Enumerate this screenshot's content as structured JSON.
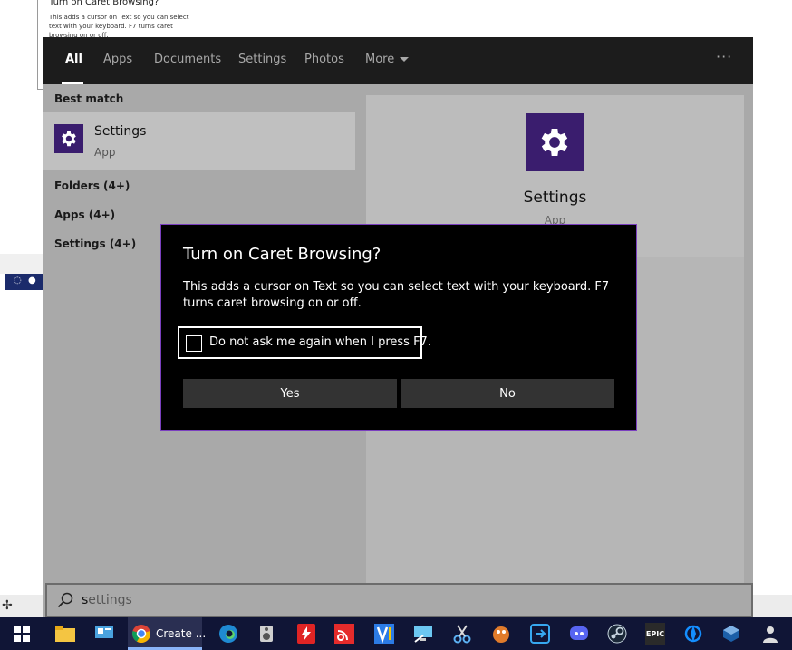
{
  "background": {
    "window_title": "Turn on Caret Browsing?",
    "window_text": "This adds a cursor on Text so you can select text with your keyboard. F7 turns caret browsing on or off."
  },
  "search_panel": {
    "tabs": [
      {
        "label": "All",
        "active": true
      },
      {
        "label": "Apps"
      },
      {
        "label": "Documents"
      },
      {
        "label": "Settings"
      },
      {
        "label": "Photos"
      },
      {
        "label": "More"
      }
    ],
    "more_options": "···",
    "best_match_heading": "Best match",
    "best_match": {
      "name": "Settings",
      "type": "App",
      "icon": "gear-icon"
    },
    "sections": [
      "Folders (4+)",
      "Apps (4+)",
      "Settings (4+)"
    ],
    "preview": {
      "name": "Settings",
      "type": "App"
    },
    "search": {
      "typed": "s",
      "completion": "ettings"
    }
  },
  "dialog": {
    "title": "Turn on Caret Browsing?",
    "body": "This adds a cursor on Text so you can select text with your keyboard. F7 turns caret browsing on or off.",
    "checkbox_label": "Do not ask me again when I press F7.",
    "checkbox_checked": false,
    "yes_label": "Yes",
    "no_label": "No"
  },
  "taskbar": {
    "chrome_label": "Create ...",
    "epic_label": "EPIC"
  },
  "colors": {
    "accent_purple": "#3a1d6e",
    "dialog_border": "#7a3fbf",
    "taskbar": "#101536"
  }
}
